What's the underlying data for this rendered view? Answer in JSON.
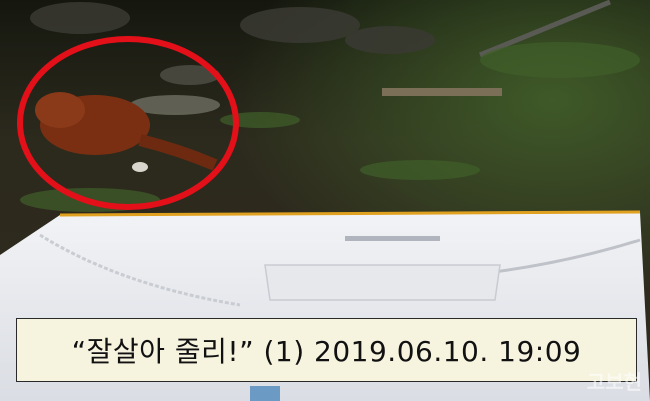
{
  "caption": {
    "text": "“잘살아 줄리!” (1) 2019.06.10. 19:09"
  },
  "watermark": {
    "text": "고보현"
  },
  "colors": {
    "highlight_circle": "#e3101a",
    "caption_background": "#f6f3df",
    "box_lid": "#eceef3"
  }
}
